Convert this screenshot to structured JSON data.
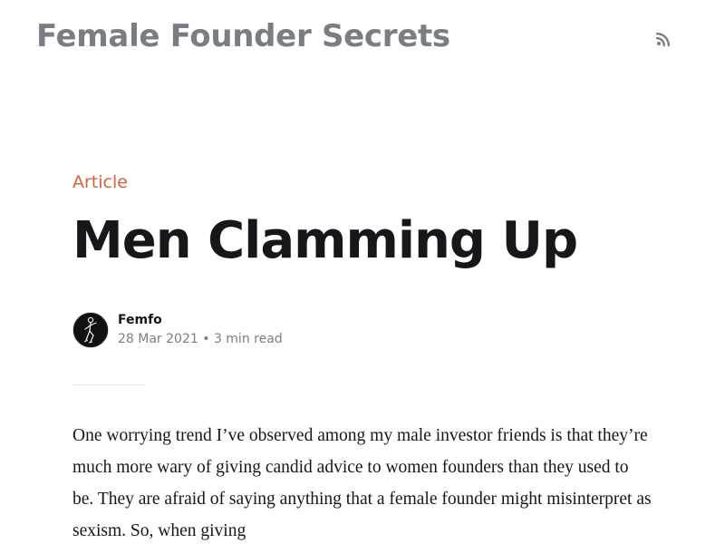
{
  "site": {
    "title": "Female Founder Secrets",
    "rss_icon": "rss-icon"
  },
  "post": {
    "tag": "Article",
    "title": "Men Clamming Up",
    "author": {
      "name": "Femfo",
      "avatar_icon": "dancing-figure-avatar"
    },
    "date": "28 Mar 2021",
    "separator": "•",
    "read_time": "3 min read",
    "body": "One worrying trend I’ve observed among my male investor friends is that they’re much more wary of giving candid advice to women founders than they used to be. They are afraid of saying anything that a female founder might misinterpret as sexism. So, when giving"
  },
  "colors": {
    "accent": "#d5623e",
    "site_title": "#7a7e84",
    "text": "#15171a",
    "muted": "#7a7e84"
  }
}
